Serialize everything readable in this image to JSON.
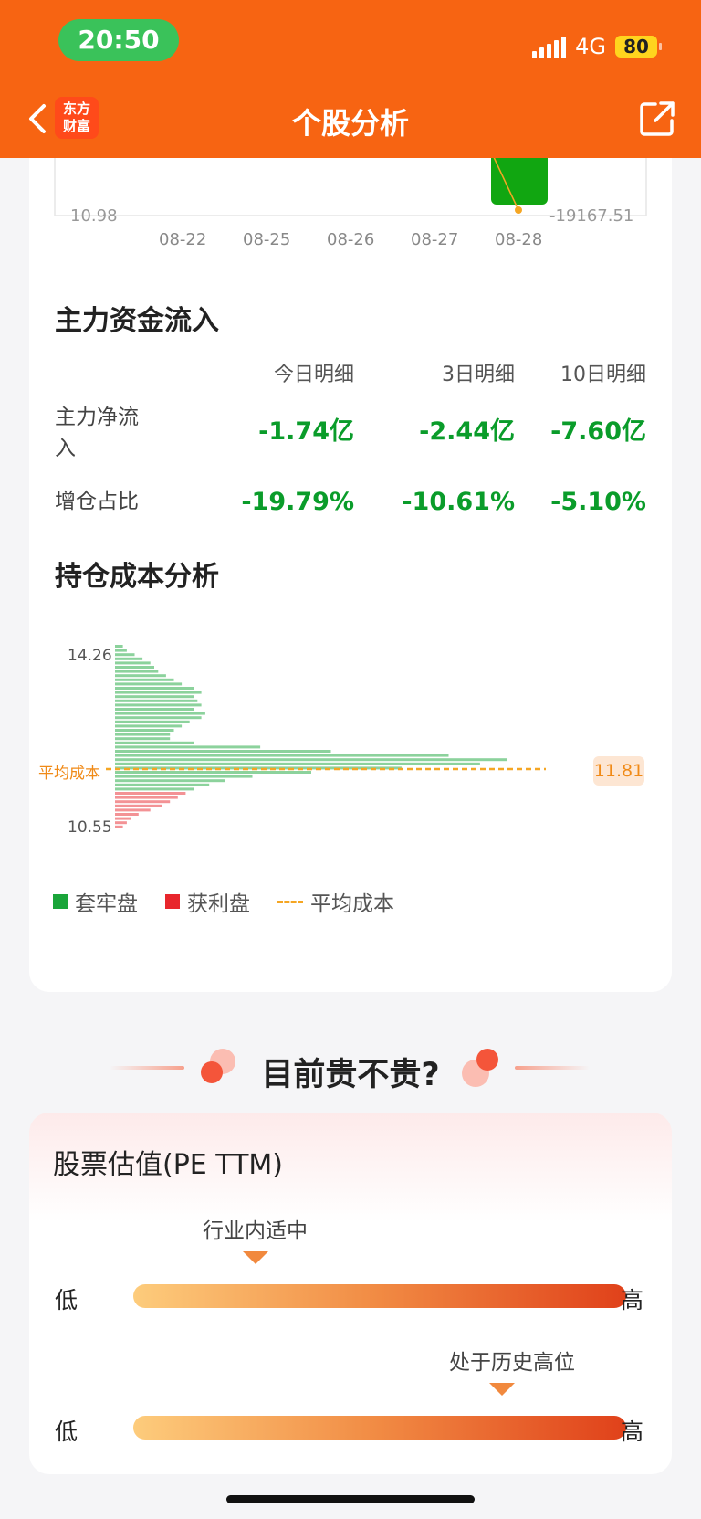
{
  "status_bar": {
    "time": "20:50",
    "network": "4G",
    "battery": "80"
  },
  "nav": {
    "title": "个股分析",
    "logo_line1": "东方",
    "logo_line2": "财富"
  },
  "fund_chart": {
    "left_value": "10.98",
    "right_value": "-19167.51",
    "dates": [
      "08-22",
      "08-25",
      "08-26",
      "08-27",
      "08-28"
    ]
  },
  "main_inflow": {
    "title": "主力资金流入",
    "headers": [
      "今日明细",
      "3日明细",
      "10日明细"
    ],
    "rows": [
      {
        "label": "主力净流入",
        "values": [
          "-1.74亿",
          "-2.44亿",
          "-7.60亿"
        ]
      },
      {
        "label": "增仓占比",
        "values": [
          "-19.79%",
          "-10.61%",
          "-5.10%"
        ]
      }
    ]
  },
  "cost_analysis": {
    "title": "持仓成本分析",
    "y_top": "14.26",
    "y_bottom": "10.55",
    "avg_label": "平均成本",
    "avg_value": "11.81",
    "legend": [
      "套牢盘",
      "获利盘",
      "平均成本"
    ],
    "colors": {
      "trapped": "#1aa53a",
      "profit": "#e8262c",
      "avg": "#f5a623"
    }
  },
  "chart_data": {
    "type": "bar",
    "title": "",
    "orientation": "horizontal",
    "y_range": [
      10.55,
      14.26
    ],
    "avg_cost": 11.81,
    "series": [
      {
        "name": "套牢盘",
        "values": [
          0.02,
          0.03,
          0.05,
          0.07,
          0.09,
          0.1,
          0.11,
          0.13,
          0.15,
          0.17,
          0.2,
          0.22,
          0.2,
          0.21,
          0.22,
          0.2,
          0.23,
          0.22,
          0.19,
          0.17,
          0.15,
          0.14,
          0.14,
          0.2,
          0.37,
          0.55,
          0.85,
          1.0,
          0.93,
          0.73,
          0.5,
          0.35,
          0.28,
          0.24,
          0.2
        ]
      },
      {
        "name": "获利盘",
        "values": [
          0.18,
          0.16,
          0.14,
          0.12,
          0.09,
          0.06,
          0.04,
          0.03,
          0.02
        ]
      }
    ]
  },
  "valuation": {
    "banner": "目前贵不贵?",
    "title": "股票估值(PE TTM)",
    "scale1": {
      "tag": "行业内适中",
      "position": 0.31,
      "low": "低",
      "high": "高"
    },
    "scale2": {
      "tag": "处于历史高位",
      "position": 0.81,
      "low": "低",
      "high": "高"
    }
  }
}
